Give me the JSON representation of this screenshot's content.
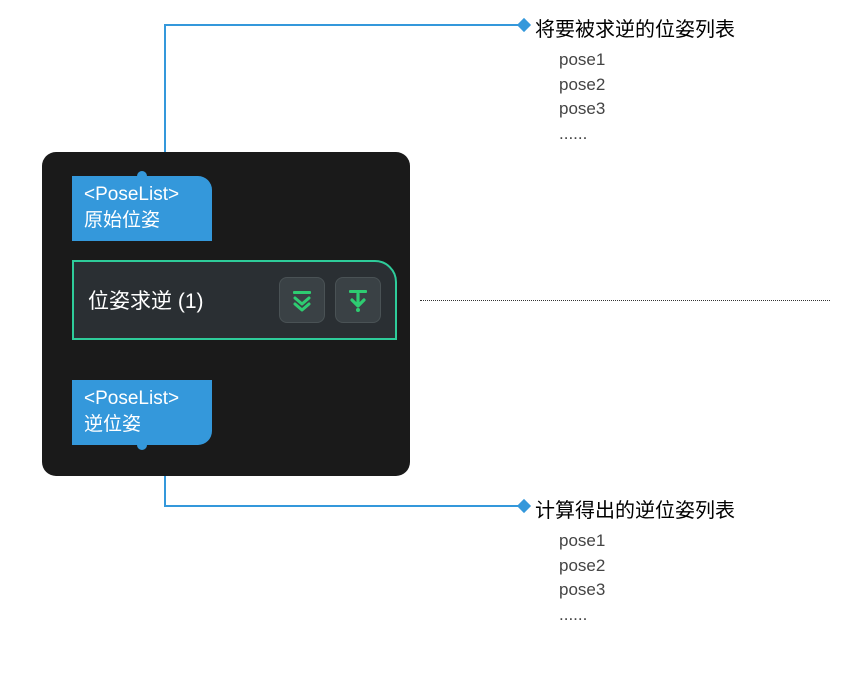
{
  "node": {
    "input_port": {
      "type": "<PoseList>",
      "label": "原始位姿"
    },
    "output_port": {
      "type": "<PoseList>",
      "label": "逆位姿"
    },
    "title": "位姿求逆 (1)"
  },
  "annotations": {
    "top": {
      "heading": "将要被求逆的位姿列表",
      "items": [
        "pose1",
        "pose2",
        "pose3",
        "......"
      ]
    },
    "bottom": {
      "heading": "计算得出的逆位姿列表",
      "items": [
        "pose1",
        "pose2",
        "pose3",
        "......"
      ]
    }
  },
  "icons": {
    "expand": "expand-chevron-icon",
    "step": "step-down-arrow-icon"
  }
}
